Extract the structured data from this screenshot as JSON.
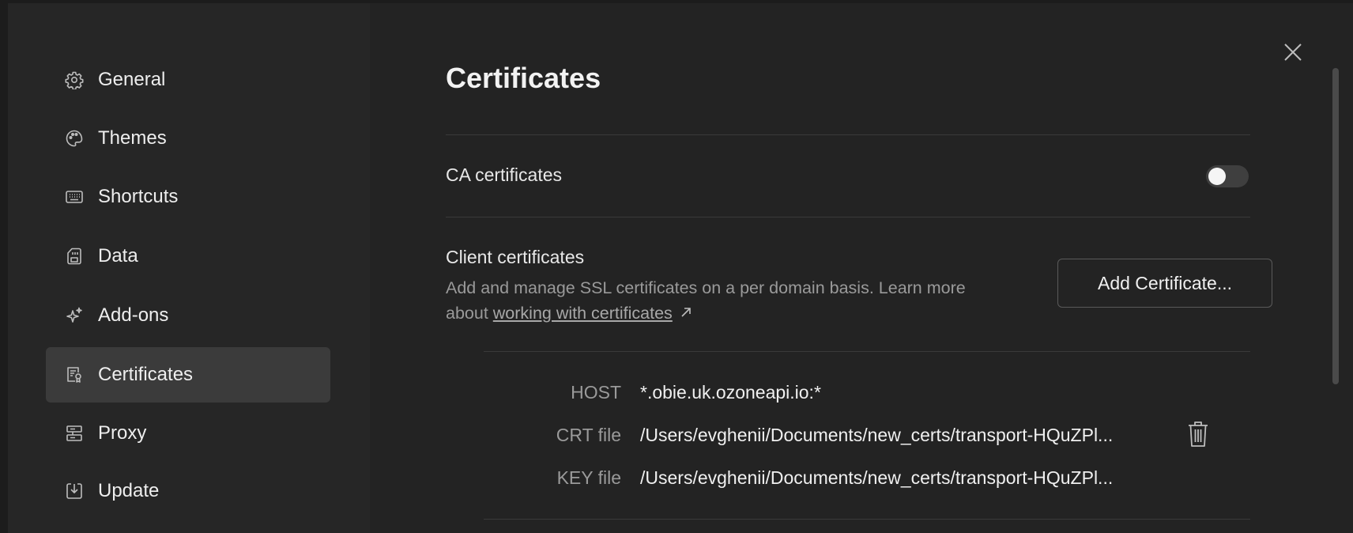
{
  "sidebar": {
    "items": [
      {
        "label": "General",
        "icon": "gear-icon"
      },
      {
        "label": "Themes",
        "icon": "palette-icon"
      },
      {
        "label": "Shortcuts",
        "icon": "keyboard-icon"
      },
      {
        "label": "Data",
        "icon": "sd-card-icon"
      },
      {
        "label": "Add-ons",
        "icon": "sparkle-icon"
      },
      {
        "label": "Certificates",
        "icon": "certificate-icon",
        "active": true
      },
      {
        "label": "Proxy",
        "icon": "server-icon"
      },
      {
        "label": "Update",
        "icon": "download-icon"
      }
    ]
  },
  "main": {
    "title": "Certificates",
    "ca": {
      "label": "CA certificates",
      "enabled": false
    },
    "client": {
      "title": "Client certificates",
      "desc_prefix": "Add and manage SSL certificates on a per domain basis. Learn more about ",
      "link_text": "working with certificates",
      "add_button": "Add Certificate..."
    },
    "entry": {
      "host_label": "HOST",
      "host_value": "*.obie.uk.ozoneapi.io:*",
      "crt_label": "CRT file",
      "crt_value": "/Users/evghenii/Documents/new_certs/transport-HQuZPl...",
      "key_label": "KEY file",
      "key_value": "/Users/evghenii/Documents/new_certs/transport-HQuZPl..."
    }
  },
  "colors": {
    "background": "#232323",
    "sidebar": "#262626",
    "active_item": "#3b3b3b"
  }
}
